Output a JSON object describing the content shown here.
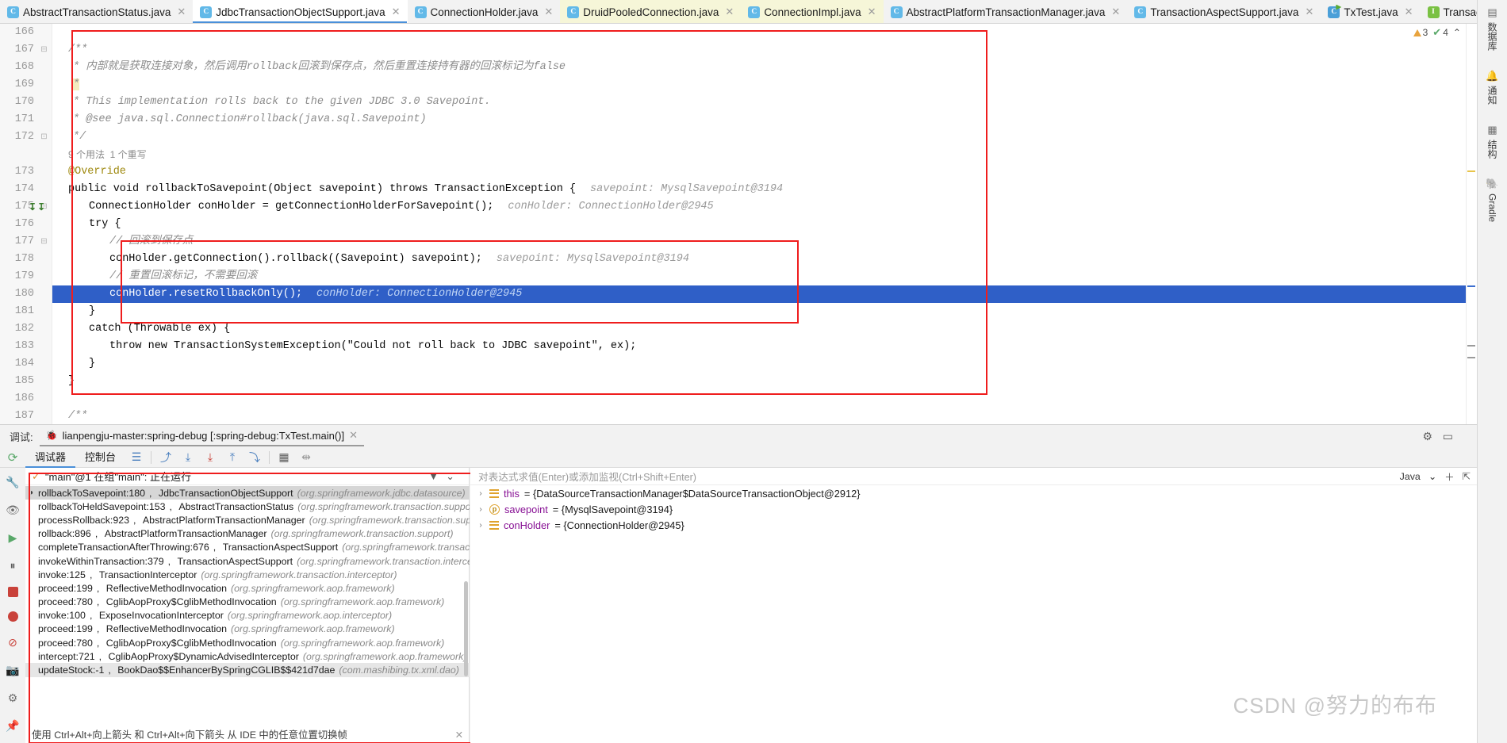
{
  "tabs": [
    {
      "label": "AbstractTransactionStatus.java",
      "icon": "class-icon",
      "state": "normal"
    },
    {
      "label": "JdbcTransactionObjectSupport.java",
      "icon": "class-icon",
      "state": "active"
    },
    {
      "label": "ConnectionHolder.java",
      "icon": "class-icon",
      "state": "normal"
    },
    {
      "label": "DruidPooledConnection.java",
      "icon": "class-icon",
      "state": "modified"
    },
    {
      "label": "ConnectionImpl.java",
      "icon": "class-icon",
      "state": "modified"
    },
    {
      "label": "AbstractPlatformTransactionManager.java",
      "icon": "class-icon",
      "state": "normal"
    },
    {
      "label": "TransactionAspectSupport.java",
      "icon": "class-icon",
      "state": "normal"
    },
    {
      "label": "TxTest.java",
      "icon": "run-class-icon",
      "state": "normal"
    },
    {
      "label": "TransactionDefinitio",
      "icon": "interface-icon",
      "state": "normal"
    }
  ],
  "tab_controls": {
    "overflow": "chevron-down-icon",
    "more": "more-vertical-icon"
  },
  "editor": {
    "inspection": {
      "warning_count": "3",
      "check_count": "4",
      "up": "⌃",
      "down": "⌄"
    },
    "lines": [
      {
        "n": "166",
        "type": "blank"
      },
      {
        "n": "167",
        "type": "jdoc",
        "text": "/**"
      },
      {
        "n": "168",
        "type": "jdoc-cn",
        "text": "* 内部就是获取连接对象，然后调用rollback回滚到保存点，然后重置连接持有器的回滚标记为false"
      },
      {
        "n": "169",
        "type": "jdoc",
        "text": "*"
      },
      {
        "n": "170",
        "type": "jdoc",
        "text": "* This implementation rolls back to the given JDBC 3.0 Savepoint."
      },
      {
        "n": "171",
        "type": "jdoc-see",
        "text": "* @see java.sql.Connection#rollback(java.sql.Savepoint)"
      },
      {
        "n": "172",
        "type": "jdoc",
        "text": "*/"
      },
      {
        "n": "",
        "type": "usage",
        "text": "9 个用法  1 个重写"
      },
      {
        "n": "173",
        "type": "annotation",
        "text": "@Override"
      },
      {
        "n": "174",
        "type": "code-sig",
        "text": "public void rollbackToSavepoint(Object savepoint) throws TransactionException {",
        "hint": "savepoint: MysqlSavepoint@3194"
      },
      {
        "n": "175",
        "type": "code",
        "text": "ConnectionHolder conHolder = getConnectionHolderForSavepoint();",
        "hint": "conHolder: ConnectionHolder@2945"
      },
      {
        "n": "176",
        "type": "code-try",
        "text": "try {"
      },
      {
        "n": "177",
        "type": "comment",
        "text": "// 回滚到保存点"
      },
      {
        "n": "178",
        "type": "code",
        "text": "conHolder.getConnection().rollback((Savepoint) savepoint);",
        "hint": "savepoint: MysqlSavepoint@3194"
      },
      {
        "n": "179",
        "type": "comment",
        "text": "// 重置回滚标记，不需要回滚"
      },
      {
        "n": "180",
        "type": "code-current",
        "text": "conHolder.resetRollbackOnly();",
        "hint": "conHolder: ConnectionHolder@2945"
      },
      {
        "n": "181",
        "type": "code",
        "text": "}"
      },
      {
        "n": "182",
        "type": "code-catch",
        "text": "catch (Throwable ex) {"
      },
      {
        "n": "183",
        "type": "code-throw",
        "text": "throw new TransactionSystemException(\"Could not roll back to JDBC savepoint\", ex);"
      },
      {
        "n": "184",
        "type": "code",
        "text": "}"
      },
      {
        "n": "185",
        "type": "code",
        "text": "}"
      },
      {
        "n": "186",
        "type": "blank"
      },
      {
        "n": "187",
        "type": "jdoc",
        "text": "/**"
      }
    ]
  },
  "right_strip": [
    {
      "label": "数据库",
      "icon": "database-icon"
    },
    {
      "label": "通知",
      "icon": "bell-icon"
    },
    {
      "label": "结构",
      "icon": "structure-icon"
    },
    {
      "label": "Gradle",
      "icon": "gradle-icon"
    }
  ],
  "debug": {
    "panel_label": "调试:",
    "session_tab": "lianpengju-master:spring-debug [:spring-debug:TxTest.main()]",
    "session_icon": "bug-icon",
    "close_icon": "close-icon",
    "settings_icon": "gear-icon",
    "hide_icon": "minimize-icon",
    "tabs": [
      {
        "label": "调试器",
        "selected": true
      },
      {
        "label": "控制台",
        "selected": false
      }
    ],
    "toolbar_icons": [
      "rerun-icon",
      "layout-icon",
      "step-over-icon",
      "step-into-icon",
      "force-step-into-icon",
      "step-out-icon",
      "run-to-cursor-icon",
      "evaluate-icon",
      "mute-breakpoints-icon"
    ],
    "left_rail_icons": [
      "wrench-icon",
      "eye-icon",
      "resume-icon",
      "pause-icon",
      "stop-icon",
      "breakpoints-icon",
      "mute-icon",
      "camera-icon",
      "settings-icon",
      "pin-icon"
    ],
    "thread": {
      "status_icon": "check-icon",
      "label": "\"main\"@1 在组\"main\": 正在运行",
      "filter_icon": "filter-icon",
      "dropdown_icon": "chevron-down-icon"
    },
    "frames": [
      {
        "method": "rollbackToSavepoint:180",
        "cls": "JdbcTransactionObjectSupport",
        "pkg": "(org.springframework.jdbc.datasource)",
        "selected": true
      },
      {
        "method": "rollbackToHeldSavepoint:153",
        "cls": "AbstractTransactionStatus",
        "pkg": "(org.springframework.transaction.support)",
        "selected": false
      },
      {
        "method": "processRollback:923",
        "cls": "AbstractPlatformTransactionManager",
        "pkg": "(org.springframework.transaction.support)",
        "selected": false
      },
      {
        "method": "rollback:896",
        "cls": "AbstractPlatformTransactionManager",
        "pkg": "(org.springframework.transaction.support)",
        "selected": false
      },
      {
        "method": "completeTransactionAfterThrowing:676",
        "cls": "TransactionAspectSupport",
        "pkg": "(org.springframework.transaction.interceptor)",
        "selected": false
      },
      {
        "method": "invokeWithinTransaction:379",
        "cls": "TransactionAspectSupport",
        "pkg": "(org.springframework.transaction.interceptor)",
        "selected": false
      },
      {
        "method": "invoke:125",
        "cls": "TransactionInterceptor",
        "pkg": "(org.springframework.transaction.interceptor)",
        "selected": false
      },
      {
        "method": "proceed:199",
        "cls": "ReflectiveMethodInvocation",
        "pkg": "(org.springframework.aop.framework)",
        "selected": false
      },
      {
        "method": "proceed:780",
        "cls": "CglibAopProxy$CglibMethodInvocation",
        "pkg": "(org.springframework.aop.framework)",
        "selected": false
      },
      {
        "method": "invoke:100",
        "cls": "ExposeInvocationInterceptor",
        "pkg": "(org.springframework.aop.interceptor)",
        "selected": false
      },
      {
        "method": "proceed:199",
        "cls": "ReflectiveMethodInvocation",
        "pkg": "(org.springframework.aop.framework)",
        "selected": false
      },
      {
        "method": "proceed:780",
        "cls": "CglibAopProxy$CglibMethodInvocation",
        "pkg": "(org.springframework.aop.framework)",
        "selected": false
      },
      {
        "method": "intercept:721",
        "cls": "CglibAopProxy$DynamicAdvisedInterceptor",
        "pkg": "(org.springframework.aop.framework)",
        "selected": false
      },
      {
        "method": "updateStock:-1",
        "cls": "BookDao$$EnhancerBySpringCGLIB$$421d7dae",
        "pkg": "(com.mashibing.tx.xml.dao)",
        "selected": false
      }
    ],
    "frames_hint": "使用 Ctrl+Alt+向上箭头 和 Ctrl+Alt+向下箭头 从 IDE 中的任意位置切换帧",
    "watch_placeholder": "对表达式求值(Enter)或添加监视(Ctrl+Shift+Enter)",
    "watch_lang": "Java",
    "watch_icons": [
      "add-watch-icon",
      "collapse-icon"
    ],
    "variables": [
      {
        "name": "this",
        "value": "= {DataSourceTransactionManager$DataSourceTransactionObject@2912}",
        "kind": "object"
      },
      {
        "name": "savepoint",
        "value": "= {MysqlSavepoint@3194}",
        "kind": "param"
      },
      {
        "name": "conHolder",
        "value": "= {ConnectionHolder@2945}",
        "kind": "object"
      }
    ]
  },
  "watermark": "CSDN @努力的布布",
  "colors": {
    "accent": "#4a90d9",
    "annotation_box": "#ef1d1d",
    "current_line": "#2f5fc7",
    "keyword": "#0033b3",
    "string": "#067d17",
    "comment": "#8c8c8c"
  }
}
